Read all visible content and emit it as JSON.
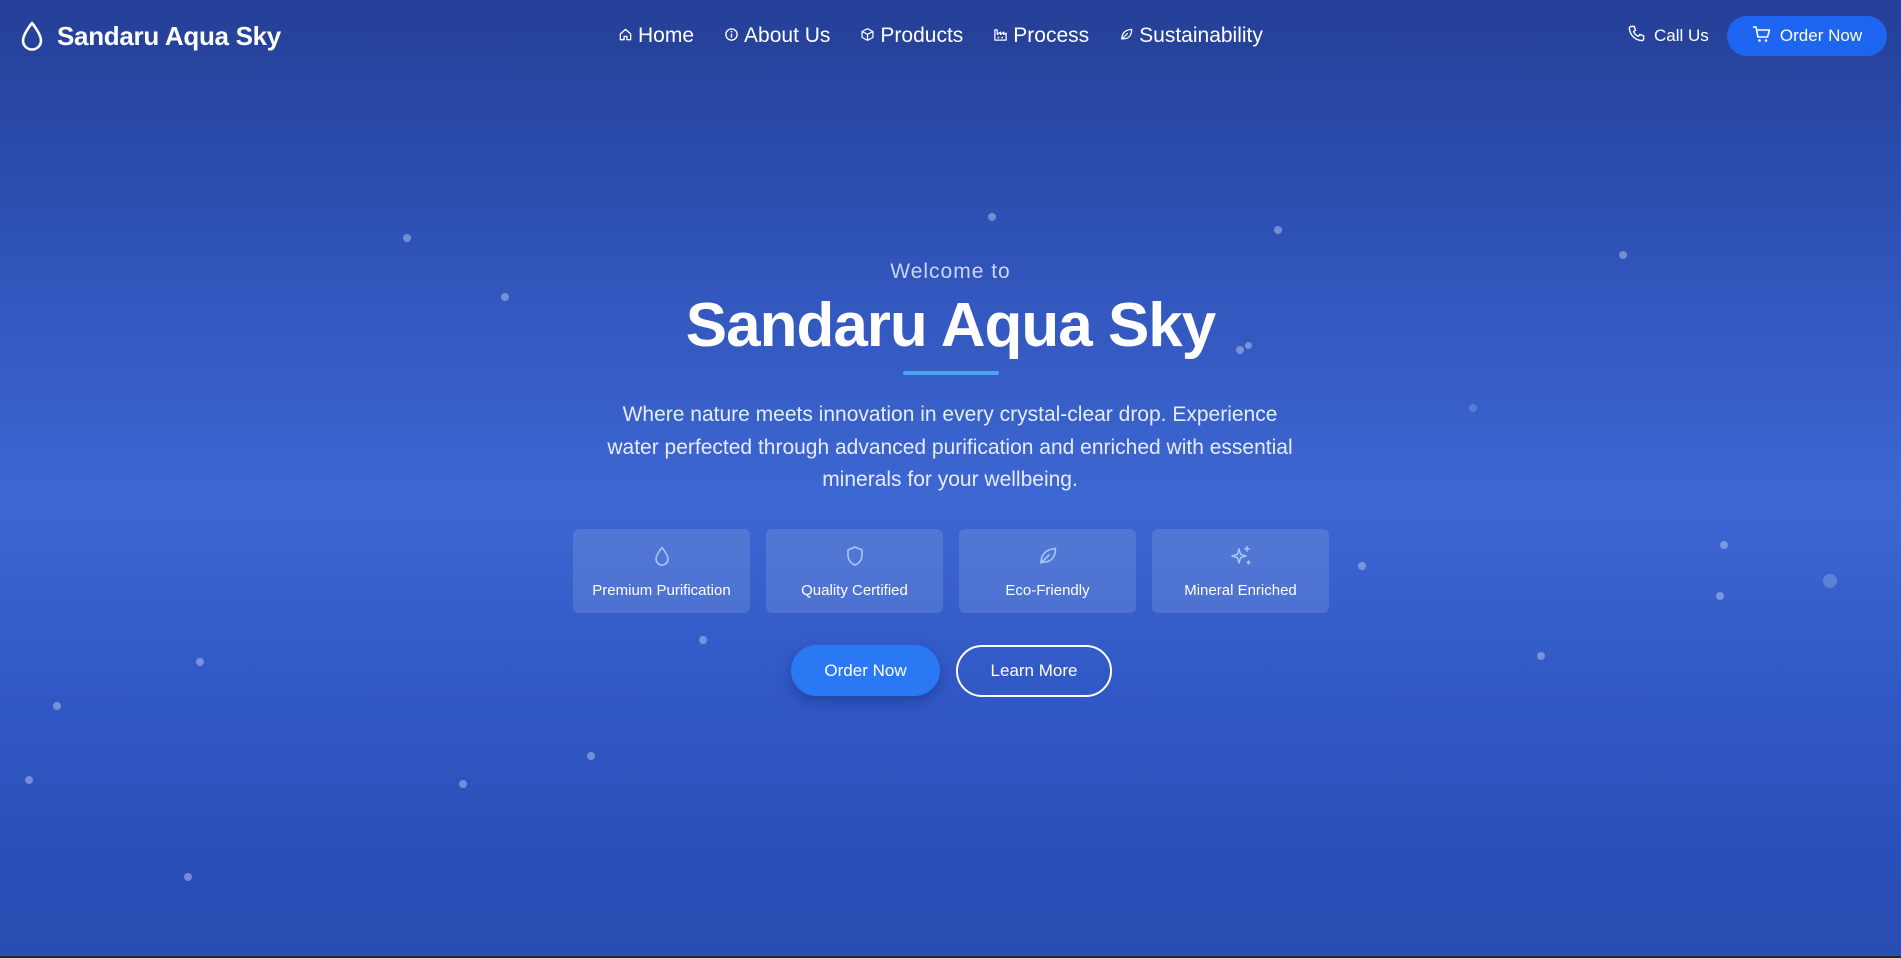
{
  "brand": {
    "name": "Sandaru Aqua Sky",
    "icon": "droplet-icon"
  },
  "nav": {
    "items": [
      {
        "label": "Home",
        "icon": "home-icon"
      },
      {
        "label": "About Us",
        "icon": "info-icon"
      },
      {
        "label": "Products",
        "icon": "box-icon"
      },
      {
        "label": "Process",
        "icon": "factory-icon"
      },
      {
        "label": "Sustainability",
        "icon": "leaf-icon"
      }
    ],
    "call_label": "Call Us",
    "order_label": "Order Now"
  },
  "hero": {
    "welcome": "Welcome to",
    "title": "Sandaru Aqua Sky",
    "description": "Where nature meets innovation in every crystal-clear drop. Experience water perfected through advanced purification and enriched with essential minerals for your wellbeing.",
    "features": [
      {
        "label": "Premium Purification",
        "icon": "droplet-icon"
      },
      {
        "label": "Quality Certified",
        "icon": "shield-icon"
      },
      {
        "label": "Eco-Friendly",
        "icon": "leaf-icon"
      },
      {
        "label": "Mineral Enriched",
        "icon": "sparkles-icon"
      }
    ],
    "primary_cta": "Order Now",
    "secondary_cta": "Learn More"
  },
  "colors": {
    "accent": "#1e66f2",
    "button_primary": "#2a78f4",
    "underline": "#4ea3ee",
    "icon_light": "#a9c6f6"
  }
}
